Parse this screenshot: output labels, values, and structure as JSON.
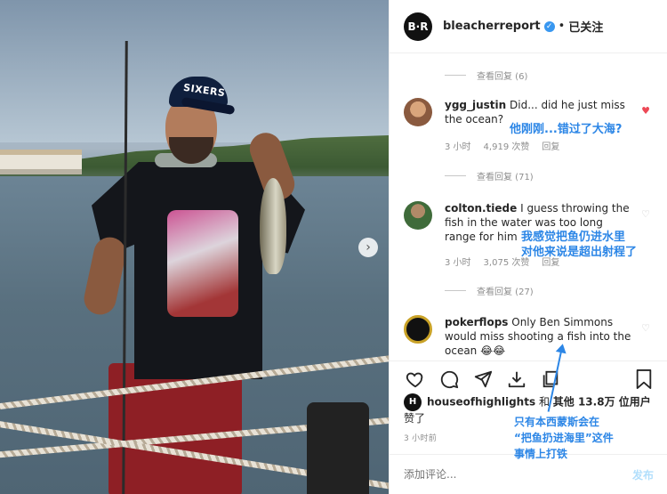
{
  "post": {
    "account": "bleacherreport",
    "logo_text": "B·R",
    "follow_status": "已关注",
    "dot": "•",
    "cap_text": "SIXERS"
  },
  "comments": [
    {
      "type": "replies",
      "label": "查看回复 (6)"
    },
    {
      "username": "ygg_justin",
      "text": "Did... did he just miss the ocean?",
      "time": "3 小时",
      "likes": "4,919 次赞",
      "reply": "回复",
      "liked": true,
      "annotation": "他刚刚...错过了大海?"
    },
    {
      "type": "replies",
      "label": "查看回复 (71)"
    },
    {
      "username": "colton.tiede",
      "text": "I guess throwing the fish in the water was too long range for him",
      "time": "3 小时",
      "likes": "3,075 次赞",
      "reply": "回复",
      "annotation_lines": [
        "我感觉把鱼仍进水里",
        "对他来说是超出射程了"
      ]
    },
    {
      "type": "replies",
      "label": "查看回复 (27)"
    },
    {
      "username": "pokerflops",
      "text": "Only Ben Simmons would miss shooting a fish into the ocean 😂😂"
    }
  ],
  "likes": {
    "avatar_text": "H",
    "user": "houseofhighlights",
    "and": "和",
    "others": "其他 13.8万 位用户",
    "liked": "赞了"
  },
  "time_ago": "3 小时前",
  "composer": {
    "placeholder": "添加评论...",
    "post_label": "发布"
  },
  "bottom_annotation": [
    "只有本西蒙斯会在",
    "“把鱼扔进海里”这件",
    "事情上打铁"
  ],
  "colors": {
    "annotation": "#2c86e6",
    "link": "#3897f0",
    "heart_liked": "#ed4956"
  },
  "icons": [
    "heart-icon",
    "comment-icon",
    "share-icon",
    "download-icon",
    "copy-icon",
    "bookmark-icon",
    "verified-icon",
    "chevron-right-icon"
  ]
}
